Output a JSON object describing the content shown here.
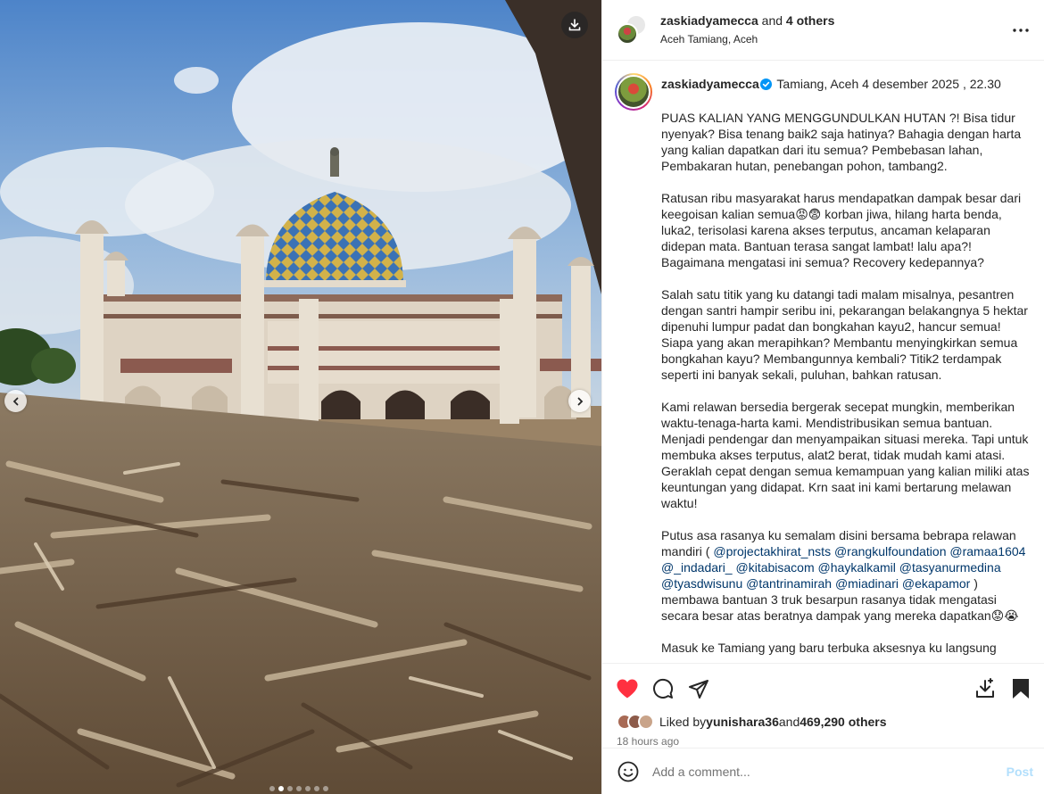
{
  "media": {
    "download_icon": "download-icon",
    "prev_icon": "chevron-left-icon",
    "next_icon": "chevron-right-icon",
    "carousel_total": 7,
    "carousel_active": 2
  },
  "header": {
    "username": "zaskiadyamecca",
    "collaborators": "and 4 others",
    "location": "Aceh Tamiang, Aceh"
  },
  "caption": {
    "username": "zaskiadyamecca",
    "meta": "Tamiang, Aceh 4 desember 2025 , 22.30",
    "p1": "PUAS KALIAN YANG MENGGUNDULKAN HUTAN ?! Bisa tidur nyenyak? Bisa tenang baik2 saja hatinya? Bahagia dengan harta yang kalian dapatkan dari itu semua? Pembebasan lahan, Pembakaran hutan, penebangan pohon, tambang2.",
    "p2": "Ratusan ribu masyarakat harus mendapatkan dampak besar dari keegoisan kalian semua😡😨 korban jiwa, hilang harta benda, luka2, terisolasi karena akses terputus, ancaman kelaparan didepan mata. Bantuan terasa sangat lambat! lalu apa?! Bagaimana mengatasi ini semua? Recovery kedepannya?",
    "p3": "Salah satu titik yang ku datangi tadi malam misalnya, pesantren dengan santri hampir seribu ini, pekarangan belakangnya 5 hektar dipenuhi lumpur padat dan bongkahan kayu2, hancur semua! Siapa yang akan merapihkan? Membantu menyingkirkan semua bongkahan kayu? Membangunnya kembali? Titik2 terdampak seperti ini banyak sekali, puluhan, bahkan ratusan.",
    "p4": "Kami relawan bersedia bergerak secepat mungkin, memberikan waktu-tenaga-harta kami. Mendistribusikan semua bantuan. Menjadi pendengar dan menyampaikan situasi mereka. Tapi untuk membuka akses terputus, alat2 berat, tidak mudah kami atasi. Geraklah cepat dengan semua kemampuan yang kalian miliki atas keuntungan yang didapat. Krn saat ini kami bertarung melawan waktu!",
    "p5_start": "Putus asa rasanya ku semalam disini bersama bebrapa relawan mandiri ( ",
    "mentions": [
      "@projectakhirat_nsts",
      "@rangkulfoundation",
      "@ramaa1604",
      "@_indadari_",
      "@kitabisacom",
      "@haykalkamil",
      "@tasyanurmedina",
      "@tyasdwisunu",
      "@tantrinamirah",
      "@miadinari",
      "@ekapamor"
    ],
    "p5_end": " ) membawa bantuan 3 truk besarpun rasanya tidak mengatasi secara besar atas beratnya dampak yang mereka dapatkan😟😭",
    "p6": "Masuk ke Tamiang yang baru terbuka aksesnya ku langsung"
  },
  "actions": {
    "like_icon": "heart-filled-icon",
    "comment_icon": "comment-icon",
    "share_icon": "share-icon",
    "save_icon": "bookmark-filled-icon",
    "download_icon": "download-icon",
    "like_color": "#ff3040"
  },
  "likes": {
    "prefix": "Liked by ",
    "user": "yunishara36",
    "middle": " and ",
    "count": "469,290 others"
  },
  "time": "18 hours ago",
  "comment": {
    "placeholder": "Add a comment...",
    "post_label": "Post"
  }
}
